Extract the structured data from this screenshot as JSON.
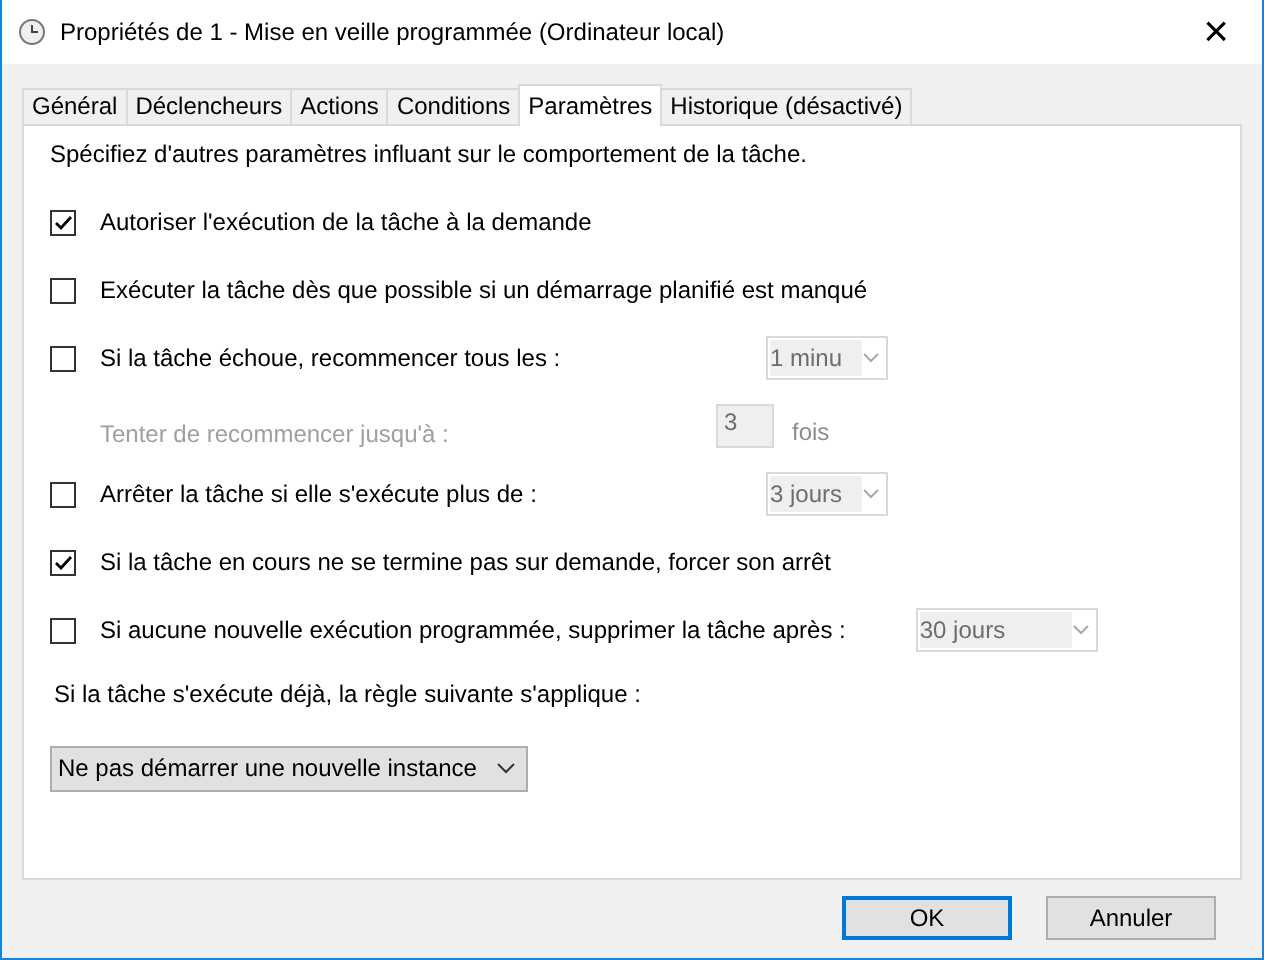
{
  "window": {
    "title": "Propriétés de 1 - Mise en veille programmée (Ordinateur local)",
    "close": "×"
  },
  "tabs": [
    {
      "label": "Général",
      "selected": false
    },
    {
      "label": "Déclencheurs",
      "selected": false
    },
    {
      "label": "Actions",
      "selected": false
    },
    {
      "label": "Conditions",
      "selected": false
    },
    {
      "label": "Paramètres",
      "selected": true
    },
    {
      "label": "Historique (désactivé)",
      "selected": false
    }
  ],
  "intro": "Spécifiez d'autres paramètres influant sur le comportement de la tâche.",
  "rows": [
    {
      "kind": "check",
      "label": "Autoriser l'exécution de la tâche à la demande",
      "checked": true
    },
    {
      "kind": "check",
      "label": "Exécuter la tâche dès que possible si un démarrage planifié est manqué",
      "checked": false
    },
    {
      "kind": "check",
      "label": "Si la tâche échoue, recommencer tous les :",
      "checked": false,
      "control": {
        "kind": "dropdown",
        "value": "1 minu",
        "disabled": true
      }
    },
    {
      "kind": "indent",
      "label": "Tenter de recommencer jusqu'à :",
      "disabled": true,
      "control": {
        "kind": "spin",
        "value": "3",
        "suffix": "fois",
        "disabled": true
      }
    },
    {
      "kind": "check",
      "label": "Arrêter la tâche si elle s'exécute plus de :",
      "checked": false,
      "control": {
        "kind": "dropdown",
        "value": "3 jours",
        "disabled": true
      }
    },
    {
      "kind": "check",
      "label": "Si la tâche en cours ne se termine pas sur demande, forcer son arrêt",
      "checked": true
    },
    {
      "kind": "check",
      "label": "Si aucune nouvelle exécution programmée, supprimer la tâche après :",
      "checked": false,
      "control": {
        "kind": "dropdown",
        "value": "30 jours",
        "disabled": true,
        "wide": true
      }
    },
    {
      "kind": "note",
      "label": "Si la tâche s'exécute déjà, la règle suivante s'applique :"
    },
    {
      "kind": "select",
      "value": "Ne pas démarrer une nouvelle instance",
      "disabled": false
    }
  ],
  "buttons": [
    {
      "label": "OK",
      "default": true
    },
    {
      "label": "Annuler",
      "default": false
    }
  ]
}
